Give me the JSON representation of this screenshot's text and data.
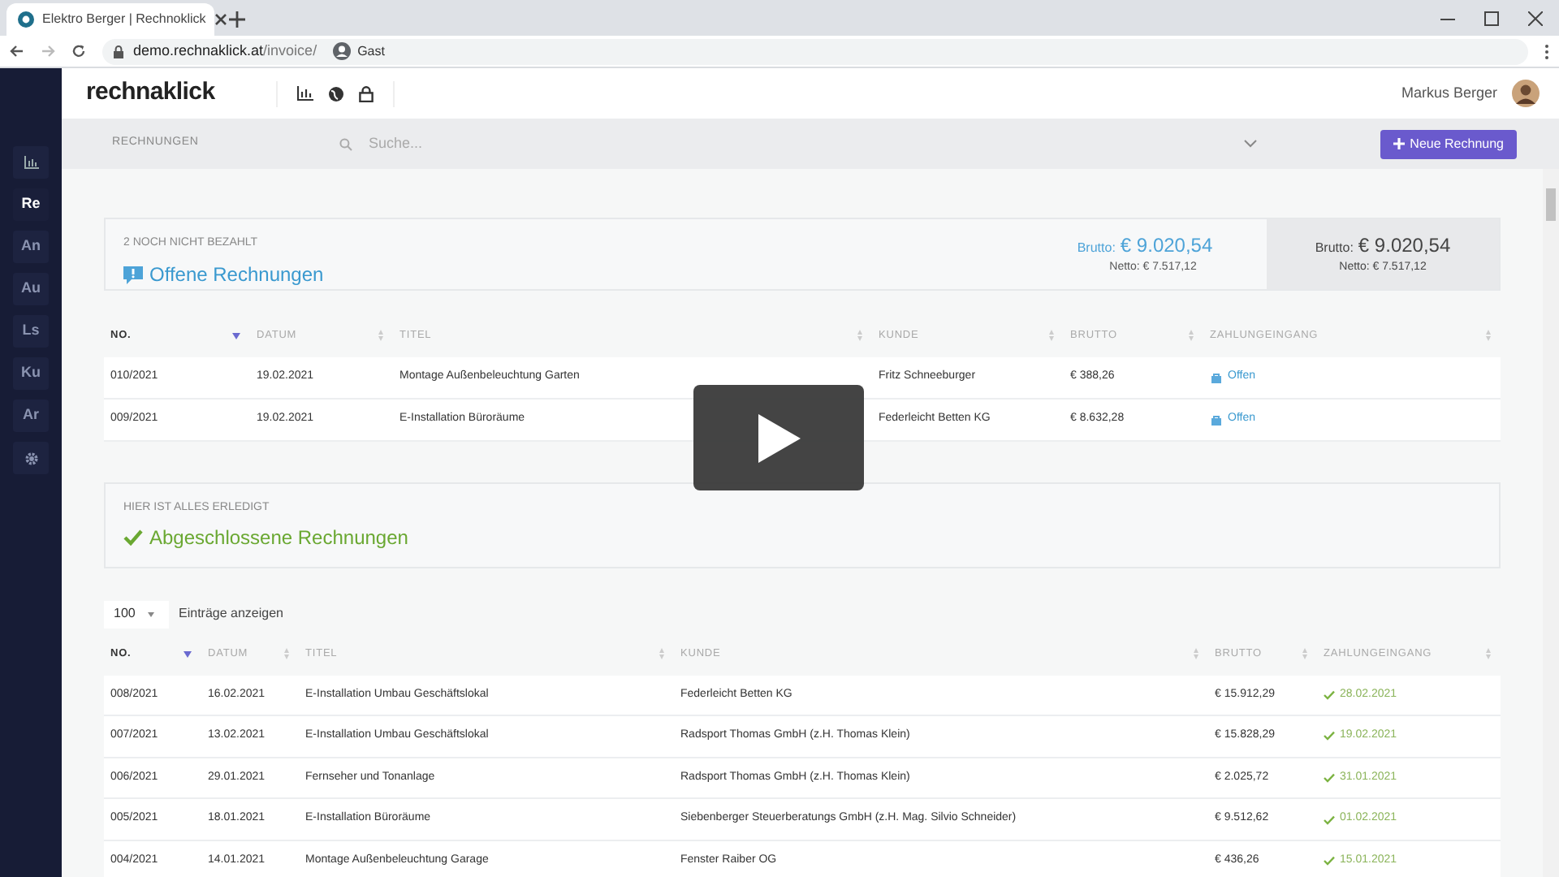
{
  "browser": {
    "tab_title": "Elektro Berger | Rechnoklick",
    "url_host": "demo.rechnaklick.at",
    "url_path": "/invoice/",
    "profile": "Gast"
  },
  "header": {
    "logo": "rechnaklick",
    "user": "Markus Berger"
  },
  "sidebar": {
    "items": [
      {
        "label": "Re",
        "selected": true
      },
      {
        "label": "An",
        "selected": false
      },
      {
        "label": "Au",
        "selected": false
      },
      {
        "label": "Ls",
        "selected": false
      },
      {
        "label": "Ku",
        "selected": false
      },
      {
        "label": "Ar",
        "selected": false
      }
    ]
  },
  "toolbar": {
    "section": "RECHNUNGEN",
    "search": {
      "placeholder": "Suche..."
    },
    "button": "Neue Rechnung"
  },
  "open_summary": {
    "eyebrow": "2 NOCH NICHT BEZAHLT",
    "title": "Offene Rechnungen",
    "brutto_label": "Brutto:",
    "brutto": "€ 9.020,54",
    "netto": "Netto: € 7.517,12",
    "total_brutto_label": "Brutto:",
    "total_brutto": "€ 9.020,54",
    "total_netto": "Netto: € 7.517,12"
  },
  "open_table": {
    "columns": [
      {
        "label": "NO.",
        "sorted": true
      },
      {
        "label": "DATUM",
        "sorted": false
      },
      {
        "label": "TITEL",
        "sorted": false
      },
      {
        "label": "KUNDE",
        "sorted": false
      },
      {
        "label": "BRUTTO",
        "sorted": false
      },
      {
        "label": "ZAHLUNGEINGANG",
        "sorted": false
      }
    ],
    "rows": [
      {
        "no": "010/2021",
        "date": "19.02.2021",
        "title": "Montage Außenbeleuchtung Garten",
        "customer": "Fritz Schneeburger",
        "brutto": "€ 388,26",
        "payment": {
          "kind": "open",
          "text": "Offen"
        }
      },
      {
        "no": "009/2021",
        "date": "19.02.2021",
        "title": "E-Installation Büroräume",
        "customer": "Federleicht Betten KG",
        "brutto": "€ 8.632,28",
        "payment": {
          "kind": "open",
          "text": "Offen"
        }
      }
    ]
  },
  "closed_summary": {
    "eyebrow": "HIER IST ALLES ERLEDIGT",
    "title": "Abgeschlossene Rechnungen"
  },
  "page_size": {
    "value": "100",
    "label": "Einträge anzeigen"
  },
  "closed_table": {
    "columns": [
      {
        "label": "NO.",
        "sorted": true
      },
      {
        "label": "DATUM",
        "sorted": false
      },
      {
        "label": "TITEL",
        "sorted": false
      },
      {
        "label": "KUNDE",
        "sorted": false
      },
      {
        "label": "BRUTTO",
        "sorted": false
      },
      {
        "label": "ZAHLUNGEINGANG",
        "sorted": false
      }
    ],
    "rows": [
      {
        "no": "008/2021",
        "date": "16.02.2021",
        "title": "E-Installation Umbau Geschäftslokal",
        "customer": "Federleicht Betten KG",
        "brutto": "€ 15.912,29",
        "payment": {
          "kind": "paid",
          "text": "28.02.2021"
        }
      },
      {
        "no": "007/2021",
        "date": "13.02.2021",
        "title": "E-Installation Umbau Geschäftslokal",
        "customer": "Radsport Thomas GmbH (z.H. Thomas Klein)",
        "brutto": "€ 15.828,29",
        "payment": {
          "kind": "paid",
          "text": "19.02.2021"
        }
      },
      {
        "no": "006/2021",
        "date": "29.01.2021",
        "title": "Fernseher und Tonanlage",
        "customer": "Radsport Thomas GmbH (z.H. Thomas Klein)",
        "brutto": "€ 2.025,72",
        "payment": {
          "kind": "paid",
          "text": "31.01.2021"
        }
      },
      {
        "no": "005/2021",
        "date": "18.01.2021",
        "title": "E-Installation Büroräume",
        "customer": "Siebenberger Steuerberatungs GmbH (z.H. Mag. Silvio Schneider)",
        "brutto": "€ 9.512,62",
        "payment": {
          "kind": "paid",
          "text": "01.02.2021"
        }
      },
      {
        "no": "004/2021",
        "date": "14.01.2021",
        "title": "Montage Außenbeleuchtung Garage",
        "customer": "Fenster Raiber OG",
        "brutto": "€ 436,26",
        "payment": {
          "kind": "paid",
          "text": "15.01.2021"
        }
      }
    ]
  }
}
